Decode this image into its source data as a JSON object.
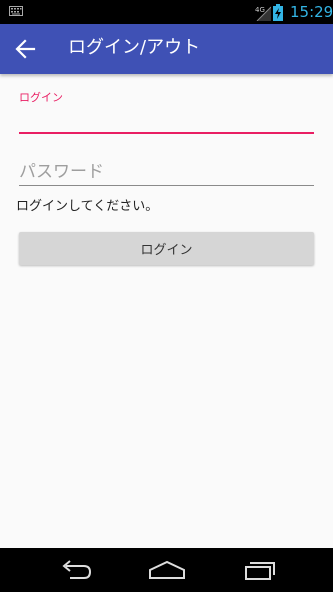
{
  "status_bar": {
    "network_label": "4G",
    "time": "15:29",
    "icons": [
      "keyboard-icon",
      "signal-icon",
      "battery-charging-icon"
    ]
  },
  "app_bar": {
    "title": "ログイン/アウト",
    "back_icon": "arrow-left-icon",
    "color": "#3f51b5"
  },
  "form": {
    "user_label": "ログイン",
    "user_value": "",
    "password_placeholder": "パスワード",
    "password_value": "",
    "accent_color": "#e91e63"
  },
  "message": "ログインしてください。",
  "login_button": {
    "label": "ログイン"
  },
  "nav_bar": {
    "icons": [
      "back-nav-icon",
      "home-nav-icon",
      "recents-nav-icon"
    ]
  }
}
